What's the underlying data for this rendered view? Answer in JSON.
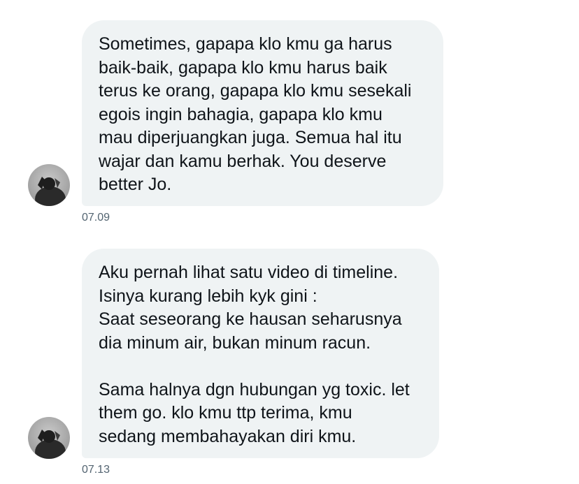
{
  "messages": [
    {
      "text": "Sometimes, gapapa klo kmu ga harus\nbaik-baik, gapapa klo kmu harus baik\nterus ke orang, gapapa klo kmu sesekali\negois ingin bahagia, gapapa klo kmu\nmau diperjuangkan juga. Semua hal itu\nwajar dan kamu berhak. You deserve\nbetter Jo.",
      "time": "07.09",
      "avatar_icon": "profile-photo"
    },
    {
      "text": "Aku pernah lihat satu video di timeline.\nIsinya kurang lebih kyk gini :\nSaat seseorang ke hausan seharusnya\ndia minum air, bukan minum racun.\n\nSama halnya dgn hubungan yg toxic. let\nthem go. klo kmu ttp terima, kmu\nsedang membahayakan diri kmu.",
      "time": "07.13",
      "avatar_icon": "profile-photo"
    }
  ],
  "colors": {
    "bubble_bg": "#eff3f4",
    "text": "#0f1419",
    "timestamp": "#536471"
  }
}
